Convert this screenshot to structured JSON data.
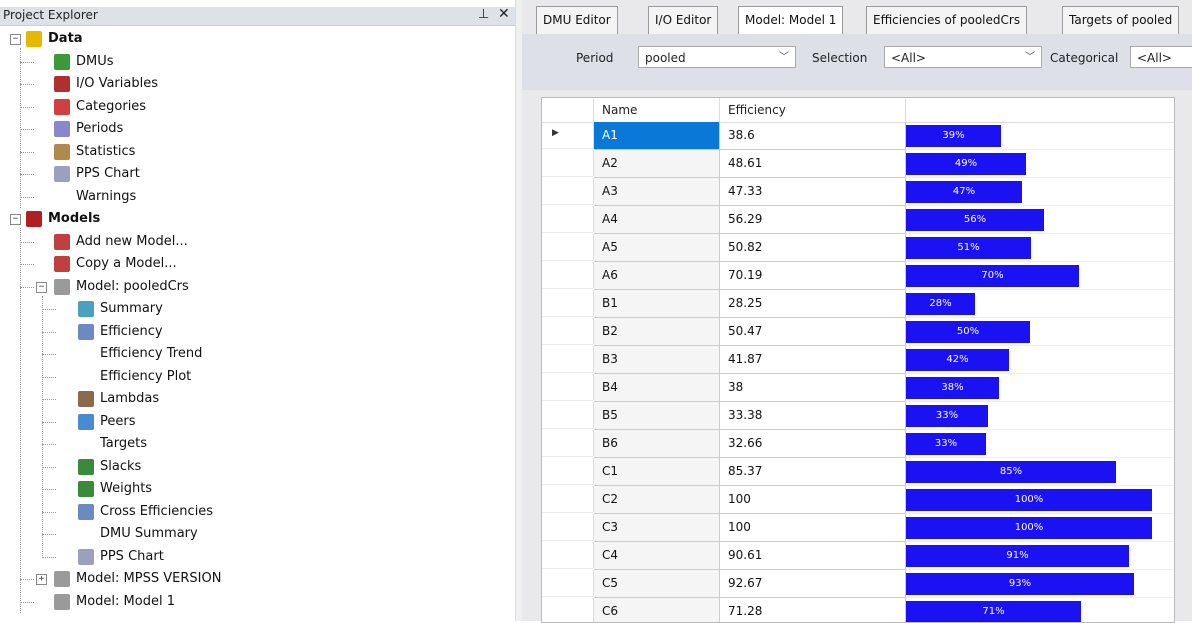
{
  "project_explorer": {
    "title": "Project Explorer",
    "pin_icon": "pin-icon",
    "close_icon": "close-icon",
    "tree": [
      {
        "label": "Data",
        "icon": "database-icon",
        "bold": true
      },
      {
        "label": "DMUs",
        "icon": "dmu-icon"
      },
      {
        "label": "I/O Variables",
        "icon": "xy-icon"
      },
      {
        "label": "Categories",
        "icon": "categories-icon"
      },
      {
        "label": "Periods",
        "icon": "periods-icon"
      },
      {
        "label": "Statistics",
        "icon": "statistics-icon"
      },
      {
        "label": "PPS Chart",
        "icon": "pps-chart-icon"
      },
      {
        "label": "Warnings",
        "icon": ""
      },
      {
        "label": "Models",
        "icon": "models-icon",
        "bold": true
      },
      {
        "label": "Add new Model...",
        "icon": "add-model-icon"
      },
      {
        "label": "Copy a Model...",
        "icon": "copy-model-icon"
      },
      {
        "label": "Model: pooledCrs",
        "icon": "model-icon"
      },
      {
        "label": "Summary",
        "icon": "summary-icon"
      },
      {
        "label": "Efficiency",
        "icon": "efficiency-icon"
      },
      {
        "label": "Efficiency Trend",
        "icon": ""
      },
      {
        "label": "Efficiency Plot",
        "icon": ""
      },
      {
        "label": "Lambdas",
        "icon": "lambda-icon"
      },
      {
        "label": "Peers",
        "icon": "peers-icon"
      },
      {
        "label": "Targets",
        "icon": ""
      },
      {
        "label": "Slacks",
        "icon": "slacks-icon"
      },
      {
        "label": "Weights",
        "icon": "weights-icon"
      },
      {
        "label": "Cross Efficiencies",
        "icon": "cross-efficiencies-icon"
      },
      {
        "label": "DMU Summary",
        "icon": ""
      },
      {
        "label": "PPS Chart",
        "icon": "pps-chart-icon"
      },
      {
        "label": "Model: MPSS VERSION",
        "icon": "model-icon"
      },
      {
        "label": "Model: Model 1",
        "icon": "model-icon"
      }
    ]
  },
  "tabs": [
    {
      "label": "DMU Editor"
    },
    {
      "label": "I/O Editor"
    },
    {
      "label": "Model: Model 1"
    },
    {
      "label": "Efficiencies of pooledCrs"
    },
    {
      "label": "Targets of pooled"
    }
  ],
  "toolbar": {
    "period_label": "Period",
    "period_value": "pooled",
    "selection_label": "Selection",
    "selection_value": "<All>",
    "categorical_label": "Categorical",
    "categorical_value": "<All>"
  },
  "grid": {
    "columns": [
      "Name",
      "Efficiency"
    ],
    "bar_color": "#1a12f3",
    "rows": [
      {
        "name": "A1",
        "efficiency": "38.6",
        "percent": "39%"
      },
      {
        "name": "A2",
        "efficiency": "48.61",
        "percent": "49%"
      },
      {
        "name": "A3",
        "efficiency": "47.33",
        "percent": "47%"
      },
      {
        "name": "A4",
        "efficiency": "56.29",
        "percent": "56%"
      },
      {
        "name": "A5",
        "efficiency": "50.82",
        "percent": "51%"
      },
      {
        "name": "A6",
        "efficiency": "70.19",
        "percent": "70%"
      },
      {
        "name": "B1",
        "efficiency": "28.25",
        "percent": "28%"
      },
      {
        "name": "B2",
        "efficiency": "50.47",
        "percent": "50%"
      },
      {
        "name": "B3",
        "efficiency": "41.87",
        "percent": "42%"
      },
      {
        "name": "B4",
        "efficiency": "38",
        "percent": "38%"
      },
      {
        "name": "B5",
        "efficiency": "33.38",
        "percent": "33%"
      },
      {
        "name": "B6",
        "efficiency": "32.66",
        "percent": "33%"
      },
      {
        "name": "C1",
        "efficiency": "85.37",
        "percent": "85%"
      },
      {
        "name": "C2",
        "efficiency": "100",
        "percent": "100%"
      },
      {
        "name": "C3",
        "efficiency": "100",
        "percent": "100%"
      },
      {
        "name": "C4",
        "efficiency": "90.61",
        "percent": "91%"
      },
      {
        "name": "C5",
        "efficiency": "92.67",
        "percent": "93%"
      },
      {
        "name": "C6",
        "efficiency": "71.28",
        "percent": "71%"
      }
    ]
  }
}
